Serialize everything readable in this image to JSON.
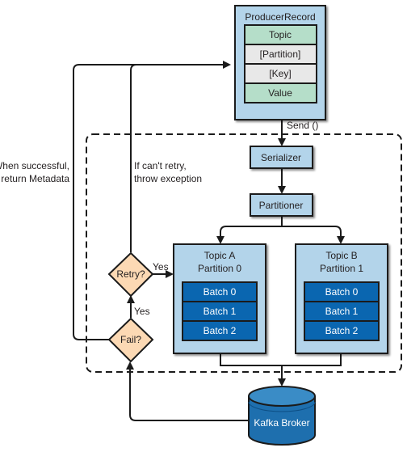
{
  "colors": {
    "light_blue": "#b3d4ea",
    "green": "#b5dec9",
    "gray": "#e8e8e8",
    "dark_blue": "#0a66b0",
    "diamond": "#fcd9b4",
    "cylinder": "#1e6fae",
    "cylinder_top": "#3a8cc6",
    "stroke": "#1b1b1b"
  },
  "producer_record": {
    "title": "ProducerRecord",
    "fields": [
      "Topic",
      "[Partition]",
      "[Key]",
      "Value"
    ]
  },
  "send_label": "Send ()",
  "serializer": "Serializer",
  "partitioner": "Partitioner",
  "partitions": [
    {
      "line1": "Topic A",
      "line2": "Partition 0",
      "batches": [
        "Batch 0",
        "Batch 1",
        "Batch 2"
      ]
    },
    {
      "line1": "Topic B",
      "line2": "Partition 1",
      "batches": [
        "Batch 0",
        "Batch 1",
        "Batch 2"
      ]
    }
  ],
  "retry": {
    "label": "Retry?",
    "yes": "Yes"
  },
  "fail": {
    "label": "Fail?",
    "yes": "Yes"
  },
  "broker": "Kafka Broker",
  "annotations": {
    "success_line1": "When successful,",
    "success_line2": "return Metadata",
    "noretry_line1": "If can't retry,",
    "noretry_line2": "throw exception"
  }
}
